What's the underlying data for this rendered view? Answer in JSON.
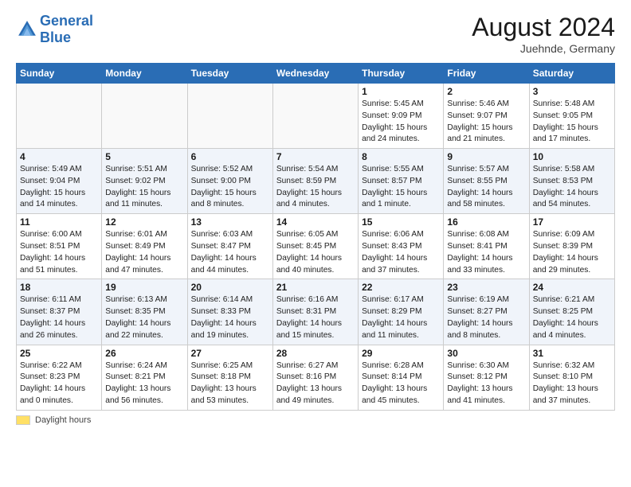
{
  "header": {
    "logo_line1": "General",
    "logo_line2": "Blue",
    "month_year": "August 2024",
    "location": "Juehnde, Germany"
  },
  "footer": {
    "daylight_label": "Daylight hours"
  },
  "weekdays": [
    "Sunday",
    "Monday",
    "Tuesday",
    "Wednesday",
    "Thursday",
    "Friday",
    "Saturday"
  ],
  "weeks": [
    [
      {
        "day": "",
        "info": ""
      },
      {
        "day": "",
        "info": ""
      },
      {
        "day": "",
        "info": ""
      },
      {
        "day": "",
        "info": ""
      },
      {
        "day": "1",
        "info": "Sunrise: 5:45 AM\nSunset: 9:09 PM\nDaylight: 15 hours\nand 24 minutes."
      },
      {
        "day": "2",
        "info": "Sunrise: 5:46 AM\nSunset: 9:07 PM\nDaylight: 15 hours\nand 21 minutes."
      },
      {
        "day": "3",
        "info": "Sunrise: 5:48 AM\nSunset: 9:05 PM\nDaylight: 15 hours\nand 17 minutes."
      }
    ],
    [
      {
        "day": "4",
        "info": "Sunrise: 5:49 AM\nSunset: 9:04 PM\nDaylight: 15 hours\nand 14 minutes."
      },
      {
        "day": "5",
        "info": "Sunrise: 5:51 AM\nSunset: 9:02 PM\nDaylight: 15 hours\nand 11 minutes."
      },
      {
        "day": "6",
        "info": "Sunrise: 5:52 AM\nSunset: 9:00 PM\nDaylight: 15 hours\nand 8 minutes."
      },
      {
        "day": "7",
        "info": "Sunrise: 5:54 AM\nSunset: 8:59 PM\nDaylight: 15 hours\nand 4 minutes."
      },
      {
        "day": "8",
        "info": "Sunrise: 5:55 AM\nSunset: 8:57 PM\nDaylight: 15 hours\nand 1 minute."
      },
      {
        "day": "9",
        "info": "Sunrise: 5:57 AM\nSunset: 8:55 PM\nDaylight: 14 hours\nand 58 minutes."
      },
      {
        "day": "10",
        "info": "Sunrise: 5:58 AM\nSunset: 8:53 PM\nDaylight: 14 hours\nand 54 minutes."
      }
    ],
    [
      {
        "day": "11",
        "info": "Sunrise: 6:00 AM\nSunset: 8:51 PM\nDaylight: 14 hours\nand 51 minutes."
      },
      {
        "day": "12",
        "info": "Sunrise: 6:01 AM\nSunset: 8:49 PM\nDaylight: 14 hours\nand 47 minutes."
      },
      {
        "day": "13",
        "info": "Sunrise: 6:03 AM\nSunset: 8:47 PM\nDaylight: 14 hours\nand 44 minutes."
      },
      {
        "day": "14",
        "info": "Sunrise: 6:05 AM\nSunset: 8:45 PM\nDaylight: 14 hours\nand 40 minutes."
      },
      {
        "day": "15",
        "info": "Sunrise: 6:06 AM\nSunset: 8:43 PM\nDaylight: 14 hours\nand 37 minutes."
      },
      {
        "day": "16",
        "info": "Sunrise: 6:08 AM\nSunset: 8:41 PM\nDaylight: 14 hours\nand 33 minutes."
      },
      {
        "day": "17",
        "info": "Sunrise: 6:09 AM\nSunset: 8:39 PM\nDaylight: 14 hours\nand 29 minutes."
      }
    ],
    [
      {
        "day": "18",
        "info": "Sunrise: 6:11 AM\nSunset: 8:37 PM\nDaylight: 14 hours\nand 26 minutes."
      },
      {
        "day": "19",
        "info": "Sunrise: 6:13 AM\nSunset: 8:35 PM\nDaylight: 14 hours\nand 22 minutes."
      },
      {
        "day": "20",
        "info": "Sunrise: 6:14 AM\nSunset: 8:33 PM\nDaylight: 14 hours\nand 19 minutes."
      },
      {
        "day": "21",
        "info": "Sunrise: 6:16 AM\nSunset: 8:31 PM\nDaylight: 14 hours\nand 15 minutes."
      },
      {
        "day": "22",
        "info": "Sunrise: 6:17 AM\nSunset: 8:29 PM\nDaylight: 14 hours\nand 11 minutes."
      },
      {
        "day": "23",
        "info": "Sunrise: 6:19 AM\nSunset: 8:27 PM\nDaylight: 14 hours\nand 8 minutes."
      },
      {
        "day": "24",
        "info": "Sunrise: 6:21 AM\nSunset: 8:25 PM\nDaylight: 14 hours\nand 4 minutes."
      }
    ],
    [
      {
        "day": "25",
        "info": "Sunrise: 6:22 AM\nSunset: 8:23 PM\nDaylight: 14 hours\nand 0 minutes."
      },
      {
        "day": "26",
        "info": "Sunrise: 6:24 AM\nSunset: 8:21 PM\nDaylight: 13 hours\nand 56 minutes."
      },
      {
        "day": "27",
        "info": "Sunrise: 6:25 AM\nSunset: 8:18 PM\nDaylight: 13 hours\nand 53 minutes."
      },
      {
        "day": "28",
        "info": "Sunrise: 6:27 AM\nSunset: 8:16 PM\nDaylight: 13 hours\nand 49 minutes."
      },
      {
        "day": "29",
        "info": "Sunrise: 6:28 AM\nSunset: 8:14 PM\nDaylight: 13 hours\nand 45 minutes."
      },
      {
        "day": "30",
        "info": "Sunrise: 6:30 AM\nSunset: 8:12 PM\nDaylight: 13 hours\nand 41 minutes."
      },
      {
        "day": "31",
        "info": "Sunrise: 6:32 AM\nSunset: 8:10 PM\nDaylight: 13 hours\nand 37 minutes."
      }
    ]
  ]
}
